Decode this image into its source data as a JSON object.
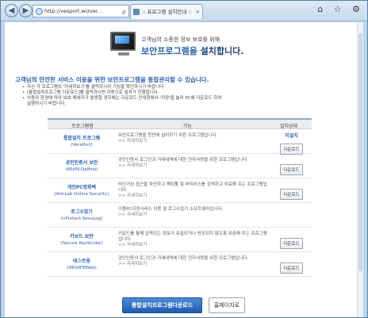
{
  "browser": {
    "address": "http://vesport.wizver...",
    "address_tools": "ρ ▾ ■ C",
    "tab_title": ":: 프로그램 설치안내 ::",
    "tab_close": "×",
    "back": "◀",
    "forward": "▶",
    "window_controls": "⌂ ☆ ⚙"
  },
  "hero": {
    "subtitle": "고객님의 소중한 정보 보호를 위해",
    "title_plain": "보안프로그램을 ",
    "title_bold": "설치합니다."
  },
  "intro": "고객님의 안전한 서비스 이용을 위한 보안프로그램을 통합관리할 수 있습니다.",
  "notes": [
    "우선 각 프로그램의 '자세히보기'를 클릭하시어 기능을 확인하시기 바랍니다.",
    "[통합설치프로그램 다운로드]를 클릭하시면 자동으로 설치가 진행됩니다.",
    "사용자 환경에 따라 보호 메세지가 발생할 경우에는 다운로드 안내창에서 '저장'을 눌러 PC에 다운로드 하여",
    "실행하시기 바랍니다."
  ],
  "table": {
    "headers": [
      "프로그램명",
      "기능",
      "설치상태"
    ],
    "rows": [
      {
        "name": "통합설치 프로그램",
        "code": "(VeraPort)",
        "func": "보안프로그램을 한번에 설치하기 위한 프로그램입니다.",
        "more": ">> 자세히보기",
        "status": "미설치",
        "button": "다운로드"
      },
      {
        "name": "공인인증서 보안",
        "code": "(WizIN-Delfino)",
        "func": "공인인증서 로그인과 거래내역에 대한 전자서명을 위한 프로그램입니다.",
        "more": ">> 자세히보기",
        "status": "",
        "button": "다운로드"
      },
      {
        "name": "개인PC방화벽",
        "code": "(AhnLab Online Security)",
        "func": "비인가된 접근을 차단하고 해킹툴 및 바이러스를 검색하고 치료해 주는 프로그램입니다.",
        "more": ">> 자세히보기",
        "status": "",
        "button": "다운로드"
      },
      {
        "name": "로그수집기",
        "code": "(nProtect-SecuLog)",
        "func": "이용PC지정서비스 이용 및 로그수집기 소프트웨어입니다.",
        "more": ">> 자세히보기",
        "status": "",
        "button": ""
      },
      {
        "name": "키보드 보안",
        "code": "(Secure KeyStroke)",
        "func": "키보드를 통해 입력되는 정보가 유출되거나 변조되지 않도록 보호해 주는 프로그램입니다.",
        "more": ">> 자세히보기",
        "status": "",
        "button": "다운로드"
      },
      {
        "name": "테스트용",
        "code": "(INISAFEWeb)",
        "func": "공인인증서 로그인과 거래내역에 대한 전자서명을 위한 프로그램입니다.",
        "more": ">> 자세히보기",
        "status": "",
        "button": "다운로드"
      }
    ]
  },
  "buttons": {
    "install_all": "통합설치프로그램다운로드",
    "home": "홈페이지로"
  }
}
